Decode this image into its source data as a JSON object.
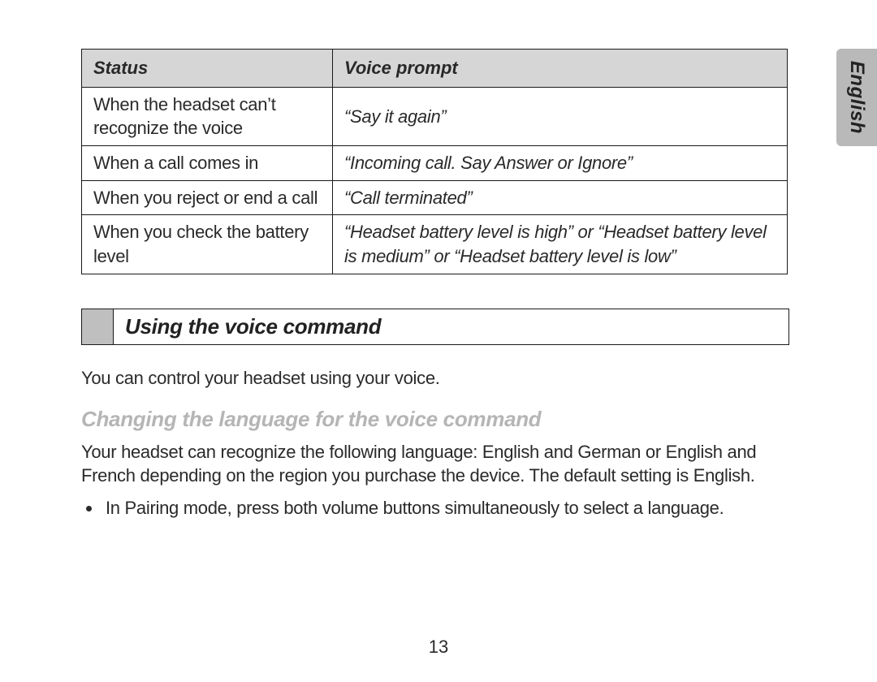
{
  "language_tab": "English",
  "table": {
    "headers": {
      "status": "Status",
      "prompt": "Voice prompt"
    },
    "rows": [
      {
        "status": "When the headset can’t recognize the voice",
        "prompt": "“Say it again”"
      },
      {
        "status": "When a call comes in",
        "prompt": "“Incoming call. Say Answer or Ignore”"
      },
      {
        "status": "When you reject or end a call",
        "prompt": "“Call terminated”"
      },
      {
        "status": "When you check the battery level",
        "prompt": "“Headset battery level is high” or “Headset battery level is medium” or “Headset battery level is low”"
      }
    ]
  },
  "section_title": "Using the voice command",
  "intro": "You can control your headset using your voice.",
  "subhead": "Changing the language for the voice command",
  "para": "Your headset can recognize the following language: English and German or English and French depending on the region you purchase the device. The default setting is English.",
  "bullet": "In Pairing mode, press both volume buttons simultaneously to select a language.",
  "page_number": "13"
}
